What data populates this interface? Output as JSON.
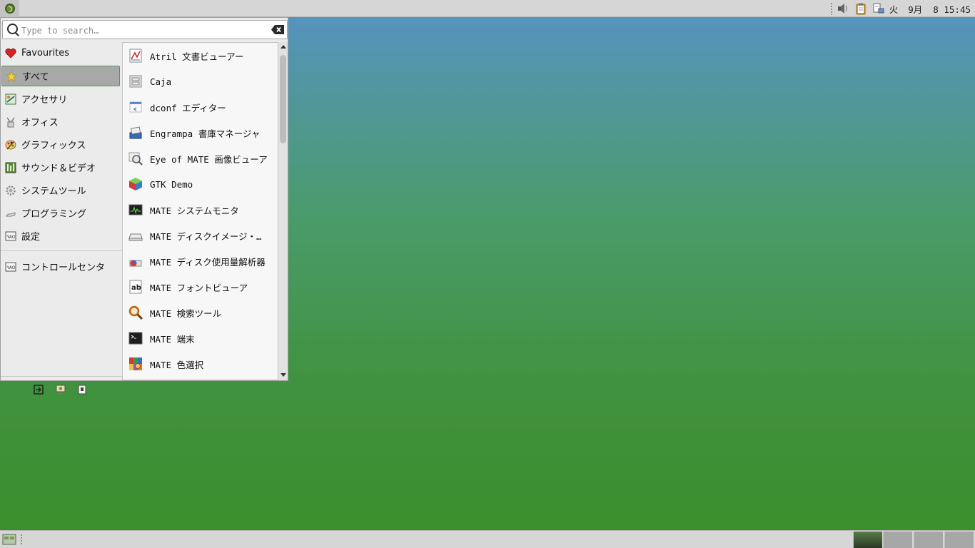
{
  "top_panel": {
    "menu_button_icon": "mate-logo-icon",
    "tray_icons": [
      "volume-icon",
      "clipboard-icon",
      "network-icon"
    ],
    "clock": {
      "weekday": "火",
      "date_time": "9月  8 15:45"
    }
  },
  "menu": {
    "search": {
      "placeholder": "Type to search…",
      "value": ""
    },
    "categories": [
      {
        "label": "Favourites",
        "icon": "heart-icon"
      },
      {
        "label": "すべて",
        "icon": "star-icon",
        "selected": true
      },
      {
        "label": "アクセサリ",
        "icon": "accessories-icon"
      },
      {
        "label": "オフィス",
        "icon": "office-icon"
      },
      {
        "label": "グラフィックス",
        "icon": "graphics-icon"
      },
      {
        "label": "サウンド＆ビデオ",
        "icon": "multimedia-icon"
      },
      {
        "label": "システムツール",
        "icon": "system-tools-icon"
      },
      {
        "label": "プログラミング",
        "icon": "programming-icon"
      },
      {
        "label": "設定",
        "icon": "settings-icon"
      }
    ],
    "control_center": {
      "label": "コントロールセンタ",
      "icon": "control-center-icon"
    },
    "bottom_actions": [
      "logout-icon",
      "lock-screen-icon",
      "shutdown-icon"
    ],
    "apps": [
      {
        "label": "Atril 文書ビューアー",
        "icon": "atril-icon"
      },
      {
        "label": "Caja",
        "icon": "caja-icon"
      },
      {
        "label": "dconf エディター",
        "icon": "dconf-icon"
      },
      {
        "label": "Engrampa 書庫マネージャ",
        "icon": "engrampa-icon"
      },
      {
        "label": "Eye of MATE 画像ビューア",
        "icon": "eom-icon"
      },
      {
        "label": "GTK Demo",
        "icon": "gtk-demo-icon"
      },
      {
        "label": "MATE システムモニタ",
        "icon": "system-monitor-icon"
      },
      {
        "label": "MATE ディスクイメージ・…",
        "icon": "disk-image-icon"
      },
      {
        "label": "MATE ディスク使用量解析器",
        "icon": "disk-usage-icon"
      },
      {
        "label": "MATE フォントビューア",
        "icon": "font-viewer-icon"
      },
      {
        "label": "MATE 検索ツール",
        "icon": "search-tool-icon"
      },
      {
        "label": "MATE 端末",
        "icon": "terminal-icon"
      },
      {
        "label": "MATE 色選択",
        "icon": "color-picker-icon"
      }
    ]
  },
  "bottom_panel": {
    "show_desktop_icon": "show-desktop-icon",
    "workspaces": 4,
    "active_workspace": 1
  },
  "colors": {
    "accent": "#4f9a55",
    "panel": "#d6d6d6",
    "desktop_top": "#5793c4",
    "desktop_bottom": "#3b8f2a"
  }
}
